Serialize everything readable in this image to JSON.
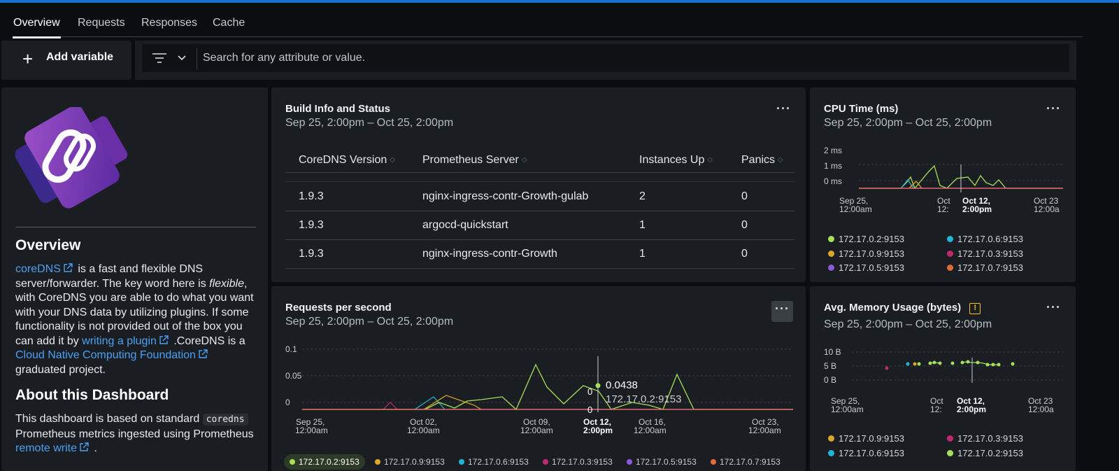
{
  "tabs": [
    "Overview",
    "Requests",
    "Responses",
    "Cache"
  ],
  "toolbar": {
    "add_variable": "Add variable",
    "search_placeholder": "Search for any attribute or value."
  },
  "left": {
    "overview_title": "Overview",
    "link_coredns": "coreDNS",
    "p1_after_link": " is a fast and flexible DNS server/forwarder. The key word here is ",
    "p1_flexible": "flexible",
    "p1_mid": ", with CoreDNS you are able to do what you want with your DNS data by utilizing plugins. If some functionality is not provided out of the box you can add it by ",
    "link_writing": "writing a plugin",
    "p1_cncf_pre": " .CoreDNS is a ",
    "link_cncf": "Cloud Native Computing Foundation",
    "p1_end": " graduated project.",
    "about_title": "About this Dashboard",
    "p2_pre": "This dashboard is based on standard ",
    "p2_code": "coredns",
    "p2_mid": " Prometheus metrics ingested using Prometheus ",
    "link_remote": "remote write",
    "p2_end": " ."
  },
  "build": {
    "title": "Build Info and Status",
    "range": "Sep 25, 2:00pm – Oct 25, 2:00pm",
    "headers": [
      "CoreDNS Version",
      "Prometheus Server",
      "Instances Up",
      "Panics"
    ],
    "rows": [
      [
        "1.9.3",
        "nginx-ingress-contr-Growth-gulab",
        "2",
        "0"
      ],
      [
        "1.9.3",
        "argocd-quickstart",
        "1",
        "0"
      ],
      [
        "1.9.3",
        "nginx-ingress-contr-Growth",
        "1",
        "0"
      ]
    ]
  },
  "cpu": {
    "title": "CPU Time (ms)",
    "range": "Sep 25, 2:00pm – Oct 25, 2:00pm",
    "yticks": [
      "2 ms",
      "1 ms",
      "0 ms"
    ],
    "xticks": [
      [
        "Sep 25,",
        "12:00am"
      ],
      [
        "Oct",
        "12:"
      ],
      [
        "Oct 12,",
        "2:00pm"
      ],
      [
        "Oct 23",
        "12:00a"
      ]
    ],
    "legend": [
      "172.17.0.2:9153",
      "172.17.0.6:9153",
      "172.17.0.9:9153",
      "172.17.0.3:9153",
      "172.17.0.5:9153",
      "172.17.0.7:9153"
    ]
  },
  "memory": {
    "title": "Avg. Memory Usage (bytes)",
    "warn": "!",
    "range": "Sep 25, 2:00pm – Oct 25, 2:00pm",
    "yticks": [
      "10 B",
      "5 B",
      "0 B"
    ],
    "xticks": [
      [
        "Sep 25,",
        "12:00am"
      ],
      [
        "Oct",
        "12:"
      ],
      [
        "Oct 12,",
        "2:00pm"
      ],
      [
        "Oct 23",
        "12:00a"
      ]
    ],
    "legend": [
      "172.17.0.9:9153",
      "172.17.0.3:9153",
      "172.17.0.6:9153",
      "172.17.0.2:9153"
    ]
  },
  "rps": {
    "title": "Requests per second",
    "range": "Sep 25, 2:00pm – Oct 25, 2:00pm",
    "yticks": [
      "0.1",
      "0.05",
      "0"
    ],
    "xticks": [
      [
        "Sep 25,",
        "12:00am"
      ],
      [
        "Oct 02,",
        "12:00am"
      ],
      [
        "Oct 09,",
        "12:00am"
      ],
      [
        "Oct 12,",
        "2:00pm"
      ],
      [
        "Oct 16,",
        "12:00am"
      ],
      [
        "Oct 23,",
        "12:00am"
      ]
    ],
    "tooltip_value": "0.0438",
    "tooltip_series": "172.17.0.2:9153",
    "tooltip_zero_a": "0",
    "tooltip_zero_b": "0",
    "legend": [
      "172.17.0.2:9153",
      "172.17.0.9:9153",
      "172.17.0.6:9153",
      "172.17.0.3:9153",
      "172.17.0.5:9153",
      "172.17.0.7:9153"
    ]
  },
  "colors": {
    "accent": "#1a6fd1",
    "s_2": "#a6e05a",
    "s_6": "#22b5d6",
    "s_9": "#d9a824",
    "s_3": "#c0296e",
    "s_5": "#8a5bd8",
    "s_7": "#e06a3a",
    "baseline": "#e06a6a"
  }
}
